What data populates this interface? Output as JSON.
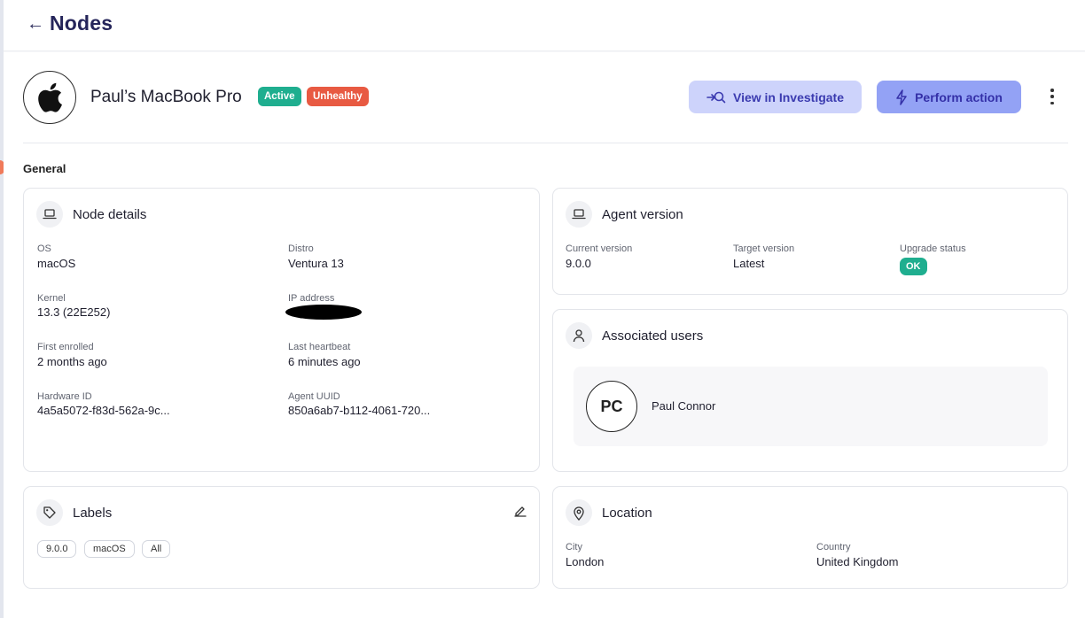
{
  "header": {
    "back_arrow": "←",
    "title": "Nodes"
  },
  "node": {
    "name": "Paul’s MacBook Pro",
    "os_icon": "apple-icon",
    "badges": {
      "active": "Active",
      "unhealthy": "Unhealthy"
    },
    "actions": {
      "investigate": "View in Investigate",
      "perform": "Perform action"
    }
  },
  "section": {
    "general": "General"
  },
  "node_details": {
    "title": "Node details",
    "icon": "laptop-icon",
    "fields": {
      "os_label": "OS",
      "os_value": "macOS",
      "distro_label": "Distro",
      "distro_value": "Ventura 13",
      "kernel_label": "Kernel",
      "kernel_value": "13.3 (22E252)",
      "ip_label": "IP address",
      "first_enrolled_label": "First enrolled",
      "first_enrolled_value": "2 months ago",
      "last_heartbeat_label": "Last heartbeat",
      "last_heartbeat_value": "6 minutes ago",
      "hardware_id_label": "Hardware ID",
      "hardware_id_value": "4a5a5072-f83d-562a-9c...",
      "agent_uuid_label": "Agent UUID",
      "agent_uuid_value": "850a6ab7-b112-4061-720..."
    }
  },
  "agent_version": {
    "title": "Agent version",
    "icon": "laptop-icon",
    "current_label": "Current version",
    "current_value": "9.0.0",
    "target_label": "Target version",
    "target_value": "Latest",
    "upgrade_label": "Upgrade status",
    "upgrade_value": "OK"
  },
  "associated_users": {
    "title": "Associated users",
    "icon": "user-icon",
    "users": [
      {
        "initials": "PC",
        "name": "Paul Connor"
      }
    ]
  },
  "labels": {
    "title": "Labels",
    "icon": "tag-icon",
    "chips": [
      "9.0.0",
      "macOS",
      "All"
    ]
  },
  "location": {
    "title": "Location",
    "icon": "map-pin-icon",
    "city_label": "City",
    "city_value": "London",
    "country_label": "Country",
    "country_value": "United Kingdom"
  },
  "colors": {
    "active": "#1fae8f",
    "unhealthy": "#e85a42",
    "investigate_bg": "#cdd3fb",
    "action_bg": "#93a2f5",
    "title": "#25255a"
  }
}
